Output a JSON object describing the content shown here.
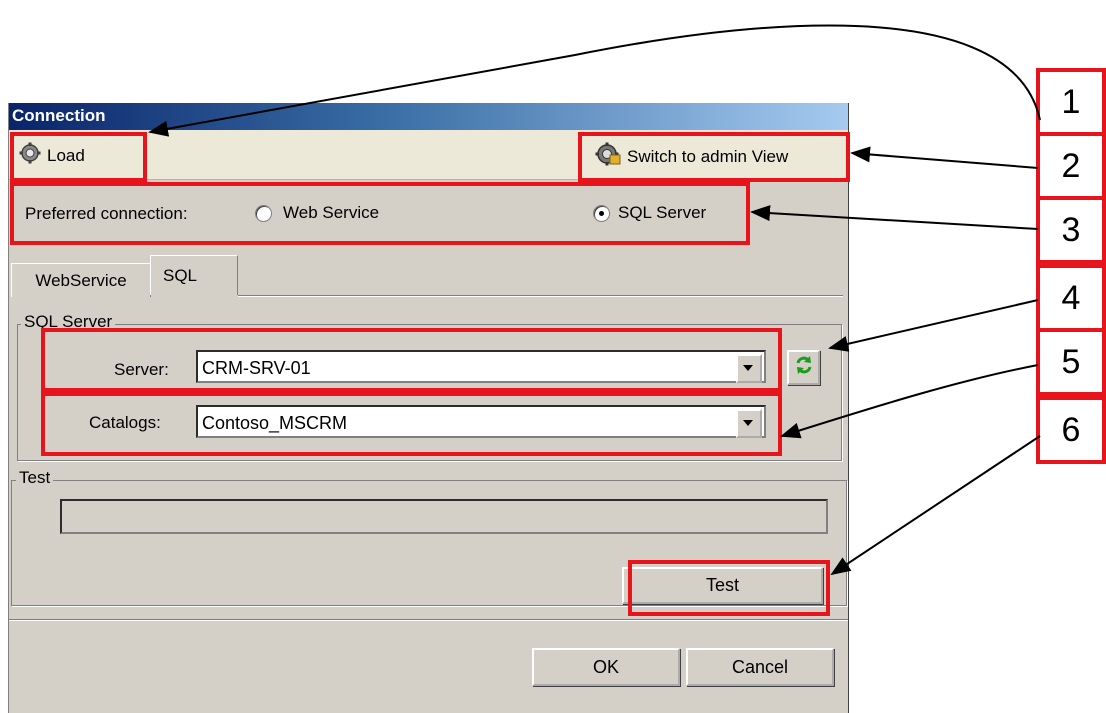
{
  "dialog": {
    "title": "Connection",
    "toolbar": {
      "load_label": "Load",
      "switch_label": "Switch to admin View"
    },
    "preferred": {
      "label": "Preferred connection:",
      "options": [
        {
          "label": "Web Service",
          "selected": false
        },
        {
          "label": "SQL Server",
          "selected": true
        }
      ]
    },
    "tabs": [
      {
        "label": "WebService",
        "active": false
      },
      {
        "label": "SQL",
        "active": true
      }
    ],
    "sql_group": {
      "legend": "SQL Server",
      "server_label": "Server:",
      "server_value": "CRM-SRV-01",
      "catalogs_label": "Catalogs:",
      "catalogs_value": "Contoso_MSCRM"
    },
    "test_group": {
      "legend": "Test",
      "progress": 0,
      "button_label": "Test"
    },
    "footer": {
      "ok_label": "OK",
      "cancel_label": "Cancel"
    }
  },
  "callouts": [
    "1",
    "2",
    "3",
    "4",
    "5",
    "6"
  ],
  "colors": {
    "highlight": "#e8141b",
    "dialog_bg": "#d4d0c8",
    "title_gradient_start": "#0a246a",
    "title_gradient_end": "#a6caf0"
  },
  "icons": [
    "gear-icon",
    "admin-gear-icon",
    "refresh-icon",
    "dropdown-arrow-icon"
  ]
}
